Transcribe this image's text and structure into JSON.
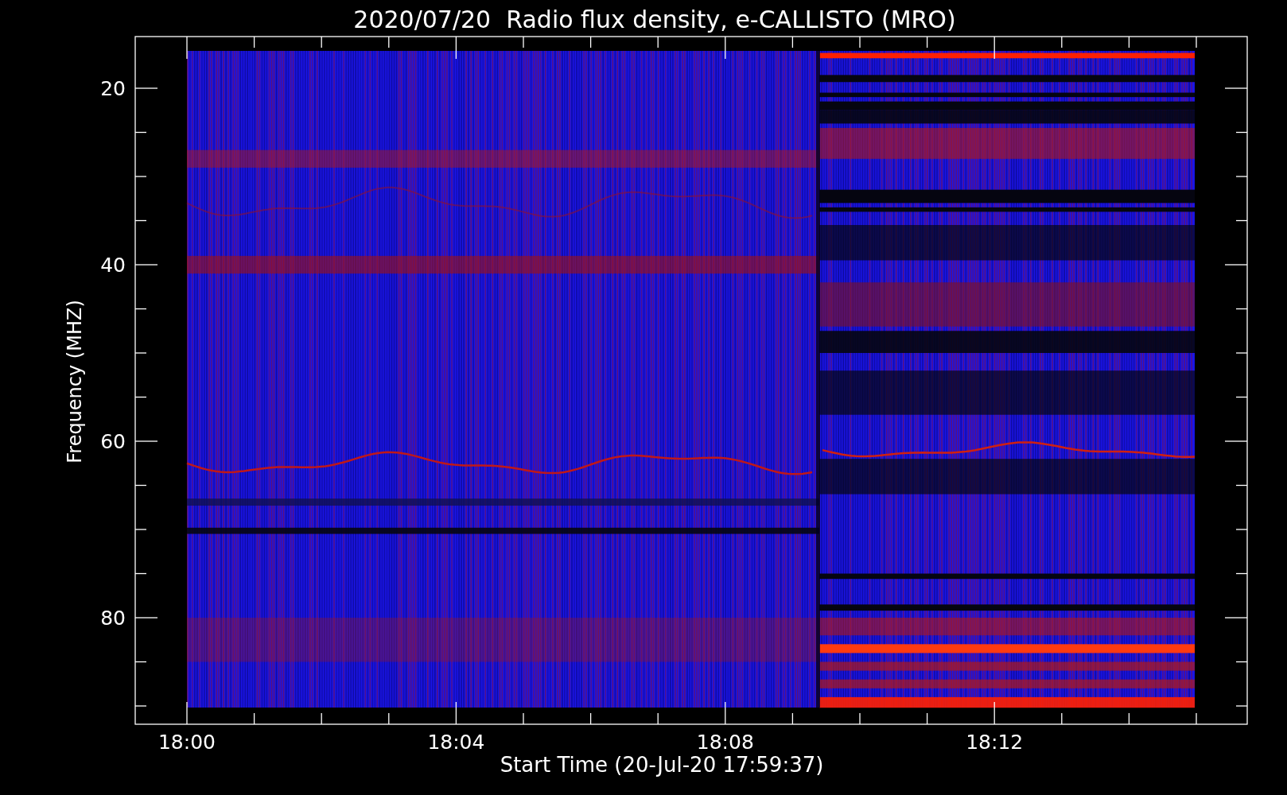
{
  "title": "2020/07/20  Radio flux density, e-CALLISTO (MRO)",
  "y_axis": {
    "label": "Frequency (MHZ)",
    "ticks": [
      "20",
      "40",
      "60",
      "80"
    ]
  },
  "x_axis": {
    "label": "Start Time (20-Jul-20 17:59:37)",
    "ticks": [
      "18:00",
      "18:04",
      "18:08",
      "18:12"
    ]
  }
}
